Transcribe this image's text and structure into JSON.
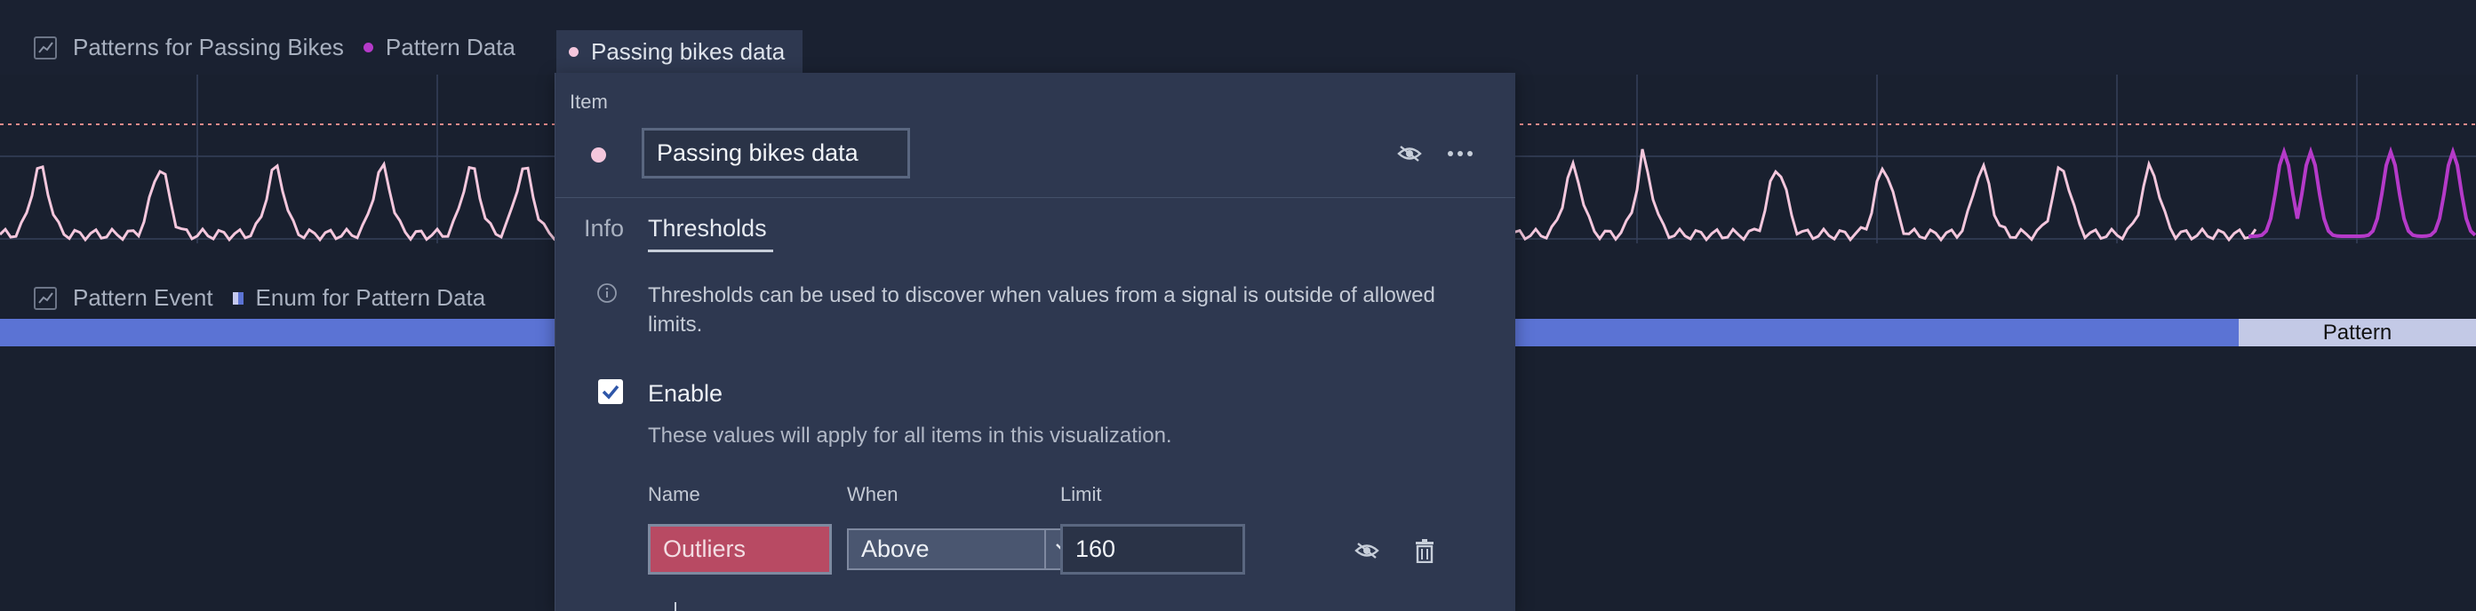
{
  "legend_top": {
    "item1_label": "Patterns for Passing Bikes",
    "item2_label": "Pattern Data",
    "item3_label": "Passing bikes data"
  },
  "legend_bottom": {
    "item1_label": "Pattern Event",
    "item2_label": "Enum for Pattern Data"
  },
  "event_bar": {
    "pattern_label": "Pattern"
  },
  "colors": {
    "series_bikes": "#f4c7dd",
    "series_pattern": "#b53ac9",
    "threshold_line": "#e78a8a",
    "event_blue": "#5b73d4",
    "outliers_bg": "#b84a63"
  },
  "panel": {
    "section_label": "Item",
    "item_name": "Passing bikes data",
    "tabs": [
      "Info",
      "Thresholds"
    ],
    "active_tab": "Thresholds",
    "info_text": "Thresholds can be used to discover when values from a signal is outside of allowed limits.",
    "enable_label": "Enable",
    "enable_checked": true,
    "apply_text": "These values will apply for all items in this visualization.",
    "columns": {
      "name": "Name",
      "when": "When",
      "limit": "Limit"
    },
    "threshold": {
      "name": "Outliers",
      "when": "Above",
      "limit": "160"
    }
  },
  "icons": [
    "line-chart-icon",
    "eye-off-icon",
    "more-icon",
    "info-icon",
    "check-icon",
    "chevron-down-icon",
    "trash-icon"
  ]
}
